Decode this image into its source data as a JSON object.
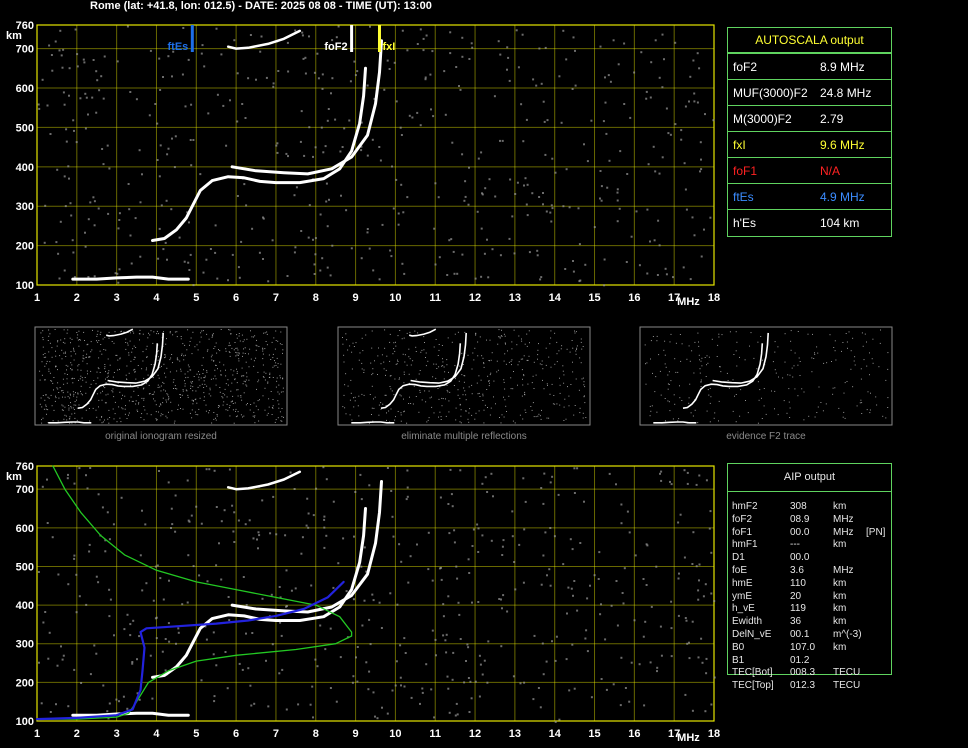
{
  "header": {
    "text": "Rome (lat: +41.8, lon: 012.5) - DATE: 2025 08 08 - TIME (UT): 13:00"
  },
  "colors": {
    "grid": "#e6e600",
    "fes": "#1e6fe8",
    "fxi": "#ffff33",
    "trace": "#ffffff",
    "aip_profile": "#23c823",
    "aip_trace": "#2222dd",
    "panel_border": "#5fd35f"
  },
  "autoscala": {
    "title": "AUTOSCALA output",
    "rows": [
      {
        "label": "foF2",
        "value": "8.9 MHz",
        "color": "#ffffff"
      },
      {
        "label": "MUF(3000)F2",
        "value": "24.8 MHz",
        "color": "#ffffff"
      },
      {
        "label": "M(3000)F2",
        "value": "2.79",
        "color": "#ffffff"
      },
      {
        "label": "fxI",
        "value": "9.6 MHz",
        "color": "#ffff33"
      },
      {
        "label": "foF1",
        "value": "N/A",
        "color": "#ff2222"
      },
      {
        "label": "ftEs",
        "value": "4.9 MHz",
        "color": "#3b8cff"
      },
      {
        "label": "h'Es",
        "value": "104    km",
        "color": "#ffffff"
      }
    ]
  },
  "aip": {
    "title": "AIP output",
    "rows": [
      {
        "name": "hmF2",
        "value": "308",
        "unit": "km",
        "extra": ""
      },
      {
        "name": "foF2",
        "value": "08.9",
        "unit": "MHz",
        "extra": ""
      },
      {
        "name": "foF1",
        "value": "00.0",
        "unit": "MHz",
        "extra": "[PN]"
      },
      {
        "name": "hmF1",
        "value": "---",
        "unit": "km",
        "extra": ""
      },
      {
        "name": "D1",
        "value": "00.0",
        "unit": "",
        "extra": ""
      },
      {
        "name": "foE",
        "value": "3.6",
        "unit": "MHz",
        "extra": ""
      },
      {
        "name": "hmE",
        "value": "110",
        "unit": "km",
        "extra": ""
      },
      {
        "name": "ymE",
        "value": "20",
        "unit": "km",
        "extra": ""
      },
      {
        "name": "h_vE",
        "value": "119",
        "unit": "km",
        "extra": ""
      },
      {
        "name": "Ewidth",
        "value": "36",
        "unit": "km",
        "extra": ""
      },
      {
        "name": "DelN_vE",
        "value": "00.1",
        "unit": "m^(-3)",
        "extra": ""
      },
      {
        "name": "B0",
        "value": "107.0",
        "unit": "km",
        "extra": ""
      },
      {
        "name": "B1",
        "value": "01.2",
        "unit": "",
        "extra": ""
      },
      {
        "name": "TEC[Bot]",
        "value": "008.3",
        "unit": "TECU",
        "extra": ""
      },
      {
        "name": "TEC[Top]",
        "value": "012.3",
        "unit": "TECU",
        "extra": ""
      }
    ]
  },
  "thumbnails": [
    {
      "caption": "original ionogram resized"
    },
    {
      "caption": "eliminate multiple reflections"
    },
    {
      "caption": "evidence F2 trace"
    }
  ],
  "chart_data": [
    {
      "type": "scatter",
      "title": "",
      "xlabel": "MHz",
      "ylabel": "km",
      "xlim": [
        1,
        18
      ],
      "ylim": [
        100,
        760
      ],
      "xticks": [
        1,
        2,
        3,
        4,
        5,
        6,
        7,
        8,
        9,
        10,
        11,
        12,
        13,
        14,
        15,
        16,
        17,
        18
      ],
      "yticks": [
        100,
        200,
        300,
        400,
        500,
        600,
        700,
        760
      ],
      "grid": true,
      "markers": [
        {
          "label": "ftEs",
          "x": 4.9
        },
        {
          "label": "foF2",
          "x": 8.9
        },
        {
          "label": "fxI",
          "x": 9.6
        }
      ],
      "series": [
        {
          "values": [
            [
              1.9,
              115
            ],
            [
              2.5,
              115
            ],
            [
              3.0,
              118
            ],
            [
              3.5,
              120
            ],
            [
              3.9,
              120
            ],
            [
              4.3,
              115
            ],
            [
              4.8,
              115
            ]
          ]
        },
        {
          "values": [
            [
              3.9,
              213
            ],
            [
              4.2,
              218
            ],
            [
              4.5,
              240
            ],
            [
              4.75,
              270
            ],
            [
              4.9,
              300
            ],
            [
              5.1,
              340
            ],
            [
              5.4,
              365
            ],
            [
              5.8,
              375
            ],
            [
              6.2,
              372
            ],
            [
              6.6,
              363
            ],
            [
              7.0,
              360
            ],
            [
              7.6,
              360
            ],
            [
              8.2,
              370
            ],
            [
              8.6,
              395
            ],
            [
              8.9,
              440
            ],
            [
              9.1,
              510
            ],
            [
              9.2,
              580
            ],
            [
              9.25,
              650
            ]
          ]
        },
        {
          "values": [
            [
              5.9,
              400
            ],
            [
              6.5,
              390
            ],
            [
              7.2,
              385
            ],
            [
              7.8,
              382
            ],
            [
              8.4,
              395
            ],
            [
              8.9,
              425
            ],
            [
              9.3,
              480
            ],
            [
              9.5,
              560
            ],
            [
              9.6,
              640
            ],
            [
              9.65,
              720
            ]
          ]
        },
        {
          "values": [
            [
              5.8,
              705
            ],
            [
              6.0,
              700
            ],
            [
              6.3,
              702
            ],
            [
              6.8,
              712
            ],
            [
              7.2,
              725
            ],
            [
              7.6,
              745
            ]
          ]
        }
      ]
    },
    {
      "type": "line",
      "title": "",
      "xlabel": "MHz",
      "ylabel": "km",
      "xlim": [
        1,
        18
      ],
      "ylim": [
        100,
        760
      ],
      "xticks": [
        1,
        2,
        3,
        4,
        5,
        6,
        7,
        8,
        9,
        10,
        11,
        12,
        13,
        14,
        15,
        16,
        17,
        18
      ],
      "yticks": [
        100,
        200,
        300,
        400,
        500,
        600,
        700,
        760
      ],
      "grid": true,
      "series": [
        {
          "values": [
            [
              1.9,
              115
            ],
            [
              2.5,
              115
            ],
            [
              3.0,
              118
            ],
            [
              3.5,
              120
            ],
            [
              3.9,
              120
            ],
            [
              4.3,
              115
            ],
            [
              4.8,
              115
            ]
          ]
        },
        {
          "values": [
            [
              3.9,
              213
            ],
            [
              4.2,
              218
            ],
            [
              4.5,
              240
            ],
            [
              4.75,
              270
            ],
            [
              4.9,
              300
            ],
            [
              5.1,
              340
            ],
            [
              5.4,
              365
            ],
            [
              5.8,
              375
            ],
            [
              6.2,
              372
            ],
            [
              6.6,
              363
            ],
            [
              7.0,
              360
            ],
            [
              7.6,
              360
            ],
            [
              8.2,
              370
            ],
            [
              8.6,
              395
            ],
            [
              8.9,
              440
            ],
            [
              9.1,
              510
            ],
            [
              9.2,
              580
            ],
            [
              9.25,
              650
            ]
          ]
        },
        {
          "values": [
            [
              5.9,
              400
            ],
            [
              6.5,
              390
            ],
            [
              7.2,
              385
            ],
            [
              7.8,
              382
            ],
            [
              8.4,
              395
            ],
            [
              8.9,
              425
            ],
            [
              9.3,
              480
            ],
            [
              9.5,
              560
            ],
            [
              9.6,
              640
            ],
            [
              9.65,
              720
            ]
          ]
        },
        {
          "values": [
            [
              5.8,
              705
            ],
            [
              6.0,
              700
            ],
            [
              6.3,
              702
            ],
            [
              6.8,
              712
            ],
            [
              7.2,
              725
            ],
            [
              7.6,
              745
            ]
          ]
        },
        {
          "values": [
            [
              1.4,
              760
            ],
            [
              1.7,
              700
            ],
            [
              2.1,
              640
            ],
            [
              2.6,
              580
            ],
            [
              3.2,
              530
            ],
            [
              4.0,
              490
            ],
            [
              5.0,
              460
            ],
            [
              6.0,
              440
            ],
            [
              7.0,
              420
            ],
            [
              8.0,
              400
            ],
            [
              8.6,
              370
            ],
            [
              8.9,
              330
            ],
            [
              8.9,
              320
            ],
            [
              8.5,
              300
            ],
            [
              7.5,
              285
            ],
            [
              6.0,
              270
            ],
            [
              5.0,
              255
            ],
            [
              4.3,
              230
            ],
            [
              3.8,
              200
            ],
            [
              3.5,
              150
            ],
            [
              3.3,
              120
            ],
            [
              3.0,
              110
            ],
            [
              2.0,
              105
            ],
            [
              1.0,
              105
            ]
          ]
        },
        {
          "values": [
            [
              1.0,
              105
            ],
            [
              2.0,
              108
            ],
            [
              3.0,
              115
            ],
            [
              3.4,
              130
            ],
            [
              3.6,
              180
            ],
            [
              3.65,
              230
            ],
            [
              3.7,
              290
            ],
            [
              3.6,
              330
            ],
            [
              3.75,
              340
            ],
            [
              4.5,
              345
            ],
            [
              5.5,
              352
            ],
            [
              6.3,
              360
            ],
            [
              7.0,
              372
            ],
            [
              7.7,
              390
            ],
            [
              8.3,
              420
            ],
            [
              8.7,
              460
            ]
          ]
        }
      ]
    }
  ]
}
